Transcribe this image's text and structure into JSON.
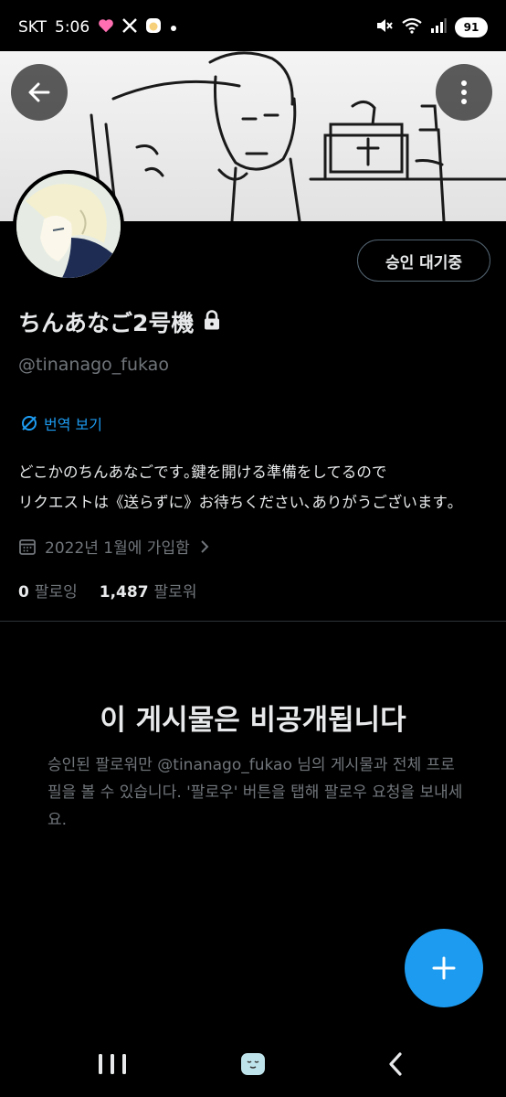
{
  "status_bar": {
    "carrier": "SKT",
    "time": "5:06",
    "battery": "91",
    "icons": [
      "heart-icon",
      "x-app-icon",
      "face-app-icon",
      "dot-icon",
      "mute-icon",
      "wifi-icon",
      "signal-icon",
      "battery-icon"
    ]
  },
  "header": {
    "back_icon": "arrow-left-icon",
    "more_icon": "more-vertical-icon"
  },
  "profile": {
    "pending_label": "승인 대기중",
    "display_name": "ちんあなご2号機",
    "lock_icon": "lock-icon",
    "handle": "@tinanago_fukao",
    "translate_label": "번역 보기",
    "bio": "どこかのちんあなごです｡鍵を開ける準備をしてるので\nリクエストは《送らずに》お待ちください､ありがうございます｡",
    "joined": "2022년 1월에 가입함",
    "following_count": "0",
    "following_label": "팔로잉",
    "followers_count": "1,487",
    "followers_label": "팔로워"
  },
  "private_notice": {
    "title": "이 게시물은 비공개됩니다",
    "description": "승인된 팔로워만 @tinanago_fukao 님의 게시물과 전체 프로필을 볼 수 있습니다. '팔로우' 버튼을 탭해 팔로우 요청을 보내세요."
  },
  "fab": {
    "icon": "plus-icon"
  },
  "nav_bar": {
    "items": [
      "recent-apps-icon",
      "home-icon",
      "back-icon"
    ]
  },
  "colors": {
    "accent": "#1d9bf0",
    "background": "#000000",
    "text_primary": "#e7e9ea",
    "text_secondary": "#71767b",
    "border": "#2f3336"
  }
}
